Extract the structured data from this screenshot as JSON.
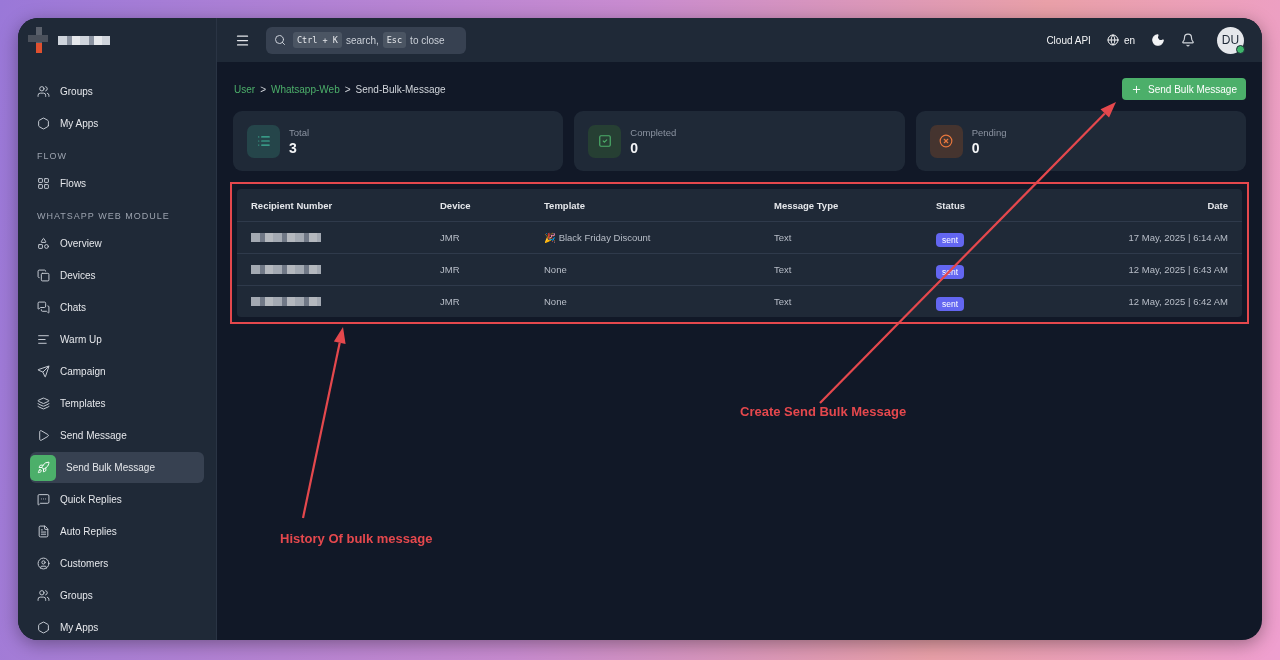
{
  "topbar": {
    "search": {
      "parts": [
        {
          "kind": "key",
          "text": "Ctrl + K"
        },
        {
          "kind": "text",
          "text": "search,"
        },
        {
          "kind": "key",
          "text": "Esc"
        },
        {
          "kind": "text",
          "text": "to close"
        }
      ]
    },
    "api_label": "Cloud API",
    "language": "en",
    "user": {
      "initials": "DU",
      "online": true
    }
  },
  "sidebar": {
    "sections": [
      {
        "items": [
          {
            "label": "Groups",
            "selected": false
          },
          {
            "label": "My Apps",
            "selected": false
          }
        ]
      },
      {
        "heading": "FLOW",
        "items": [
          {
            "label": "Flows",
            "selected": false
          }
        ]
      },
      {
        "heading": "WHATSAPP WEB MODULE",
        "items": [
          {
            "label": "Overview",
            "selected": false
          },
          {
            "label": "Devices",
            "selected": false
          },
          {
            "label": "Chats",
            "selected": false
          },
          {
            "label": "Warm Up",
            "selected": false
          },
          {
            "label": "Campaign",
            "selected": false
          },
          {
            "label": "Templates",
            "selected": false
          },
          {
            "label": "Send Message",
            "selected": false
          },
          {
            "label": "Send Bulk Message",
            "selected": true
          },
          {
            "label": "Quick Replies",
            "selected": false
          },
          {
            "label": "Auto Replies",
            "selected": false
          },
          {
            "label": "Customers",
            "selected": false
          },
          {
            "label": "Groups",
            "selected": false
          },
          {
            "label": "My Apps",
            "selected": false
          }
        ]
      }
    ]
  },
  "breadcrumb": [
    {
      "label": "User",
      "link": true
    },
    {
      "label": ">",
      "link": false
    },
    {
      "label": "Whatsapp-Web",
      "link": true
    },
    {
      "label": ">",
      "link": false
    },
    {
      "label": "Send-Bulk-Message",
      "link": false
    }
  ],
  "primary_button": "Send Bulk Message",
  "stats": [
    {
      "kind": "total",
      "label": "Total",
      "value": "3"
    },
    {
      "kind": "completed",
      "label": "Completed",
      "value": "0"
    },
    {
      "kind": "pending",
      "label": "Pending",
      "value": "0"
    }
  ],
  "table": {
    "columns": [
      "Recipient Number",
      "Device",
      "Template",
      "Message Type",
      "Status",
      "Date"
    ],
    "rows": [
      {
        "device": "JMR",
        "template": "🎉 Black Friday Discount",
        "message_type": "Text",
        "status": "sent",
        "date": "17 May, 2025 | 6:14 AM"
      },
      {
        "device": "JMR",
        "template": "None",
        "message_type": "Text",
        "status": "sent",
        "date": "12 May, 2025 | 6:43 AM"
      },
      {
        "device": "JMR",
        "template": "None",
        "message_type": "Text",
        "status": "sent",
        "date": "12 May, 2025 | 6:42 AM"
      }
    ]
  },
  "annotations": [
    {
      "text": "Create Send Bulk Message"
    },
    {
      "text": "History Of bulk message"
    }
  ]
}
